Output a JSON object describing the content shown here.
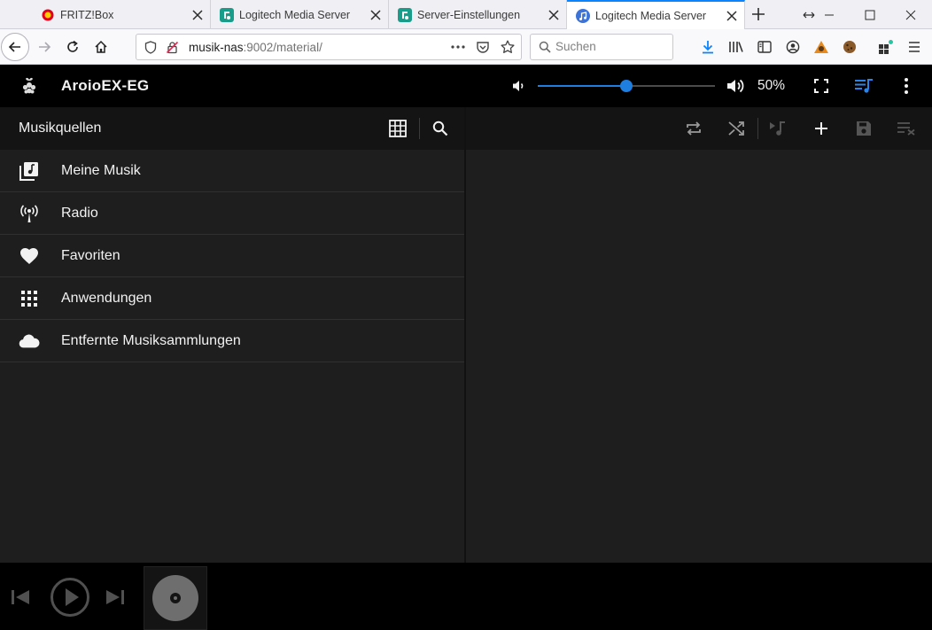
{
  "browser": {
    "tabs": [
      {
        "title": "FRITZ!Box",
        "favicon": "fritzbox-icon",
        "active": false
      },
      {
        "title": "Logitech Media Server",
        "favicon": "lms-icon",
        "active": false
      },
      {
        "title": "Server-Einstellungen",
        "favicon": "lms-icon",
        "active": false
      },
      {
        "title": "Logitech Media Server",
        "favicon": "music-note-icon",
        "active": true
      }
    ],
    "url_host": "musik-nas",
    "url_rest": ":9002/material/",
    "search_placeholder": "Suchen",
    "accent_color": "#0a84ff"
  },
  "app": {
    "player_name": "AroioEX-EG",
    "volume_percent": 50,
    "volume_label": "50%",
    "accent_color": "#1e7fe0",
    "browse": {
      "title": "Musikquellen",
      "items": [
        {
          "label": "Meine Musik",
          "icon": "library-music-icon"
        },
        {
          "label": "Radio",
          "icon": "radio-tower-icon"
        },
        {
          "label": "Favoriten",
          "icon": "heart-icon"
        },
        {
          "label": "Anwendungen",
          "icon": "apps-grid-icon"
        },
        {
          "label": "Entfernte Musiksammlungen",
          "icon": "cloud-icon"
        }
      ]
    }
  }
}
